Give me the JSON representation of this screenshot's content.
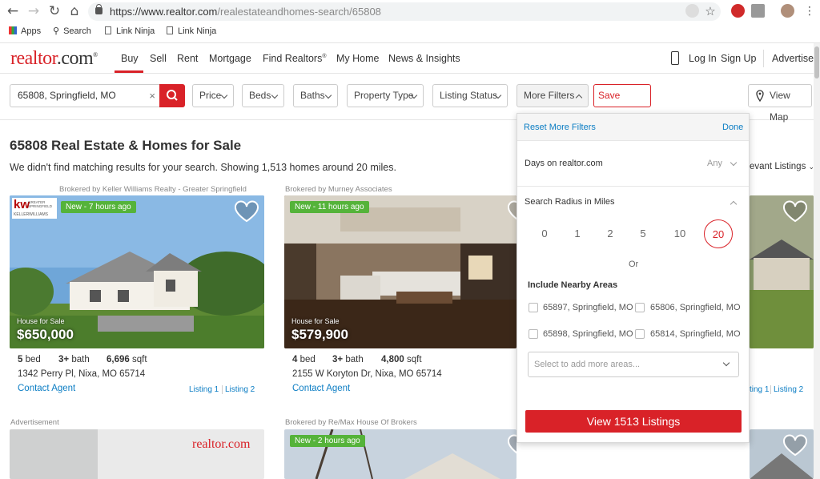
{
  "browser": {
    "url_scheme": "https://www.realtor.com",
    "url_path": "/realestateandhomes-search/65808",
    "bookmarks": [
      "Apps",
      "Search",
      "Link Ninja",
      "Link Ninja"
    ]
  },
  "header": {
    "logo_main": "realtor",
    "logo_suffix": ".com",
    "logo_reg": "®",
    "nav": [
      "Buy",
      "Sell",
      "Rent",
      "Mortgage",
      "Find Realtors",
      "My Home",
      "News & Insights"
    ],
    "find_realtors_sup": "®",
    "login": "Log In",
    "signup": "Sign Up",
    "advertise": "Advertise"
  },
  "filters": {
    "search_value": "65808, Springfield, MO",
    "price": "Price",
    "beds": "Beds",
    "baths": "Baths",
    "property_type": "Property Type",
    "listing_status": "Listing Status",
    "more_filters": "More Filters",
    "save_search": "Save Search",
    "view_map": "View Map"
  },
  "main": {
    "title": "65808 Real Estate & Homes for Sale",
    "subtitle": "We didn't find matching results for your search. Showing 1,513 homes around 20 miles.",
    "sort": "evant Listings"
  },
  "cards": [
    {
      "broker": "Brokered by Keller Williams Realty - Greater Springfield",
      "badge": "New - 7 hours ago",
      "type": "House for Sale",
      "price": "$650,000",
      "beds": "5",
      "beds_label": "bed",
      "baths": "3+",
      "baths_label": "bath",
      "sqft": "6,696",
      "sqft_label": "sqft",
      "address": "1342 Perry Pl, Nixa, MO 65714",
      "contact": "Contact Agent",
      "listing1": "Listing 1",
      "listing2": "Listing 2",
      "logo_kw": "kw",
      "logo_line1": "GREATER SPRINGFIELD",
      "logo_line2": "KELLERWILLIAMS"
    },
    {
      "broker": "Brokered by Murney Associates",
      "badge": "New - 11 hours ago",
      "type": "House for Sale",
      "price": "$579,900",
      "beds": "4",
      "beds_label": "bed",
      "baths": "3+",
      "baths_label": "bath",
      "sqft": "4,800",
      "sqft_label": "sqft",
      "address": "2155 W Koryton Dr, Nixa, MO 65714",
      "contact": "Contact Agent"
    },
    {
      "listing1": "ting 1",
      "listing2": "Listing 2"
    }
  ],
  "row2": {
    "advertisement": "Advertisement",
    "ad_logo": "realtor.com",
    "broker": "Brokered by Re/Max House Of Brokers",
    "badge": "New - 2 hours ago"
  },
  "more_filters_panel": {
    "reset": "Reset More Filters",
    "done": "Done",
    "days_label": "Days on realtor.com",
    "days_value": "Any",
    "radius_label": "Search Radius in Miles",
    "radius_options": [
      "0",
      "1",
      "2",
      "5",
      "10",
      "20"
    ],
    "radius_selected": "20",
    "or": "Or",
    "nearby_label": "Include Nearby Areas",
    "areas": [
      "65897, Springfield, MO",
      "65806, Springfield, MO",
      "65898, Springfield, MO",
      "65814, Springfield, MO"
    ],
    "area_placeholder": "Select to add more areas...",
    "view_button": "View 1513 Listings"
  },
  "colors": {
    "brand_red": "#d92228",
    "link_blue": "#0d7ec4",
    "badge_green": "#55b33a"
  }
}
